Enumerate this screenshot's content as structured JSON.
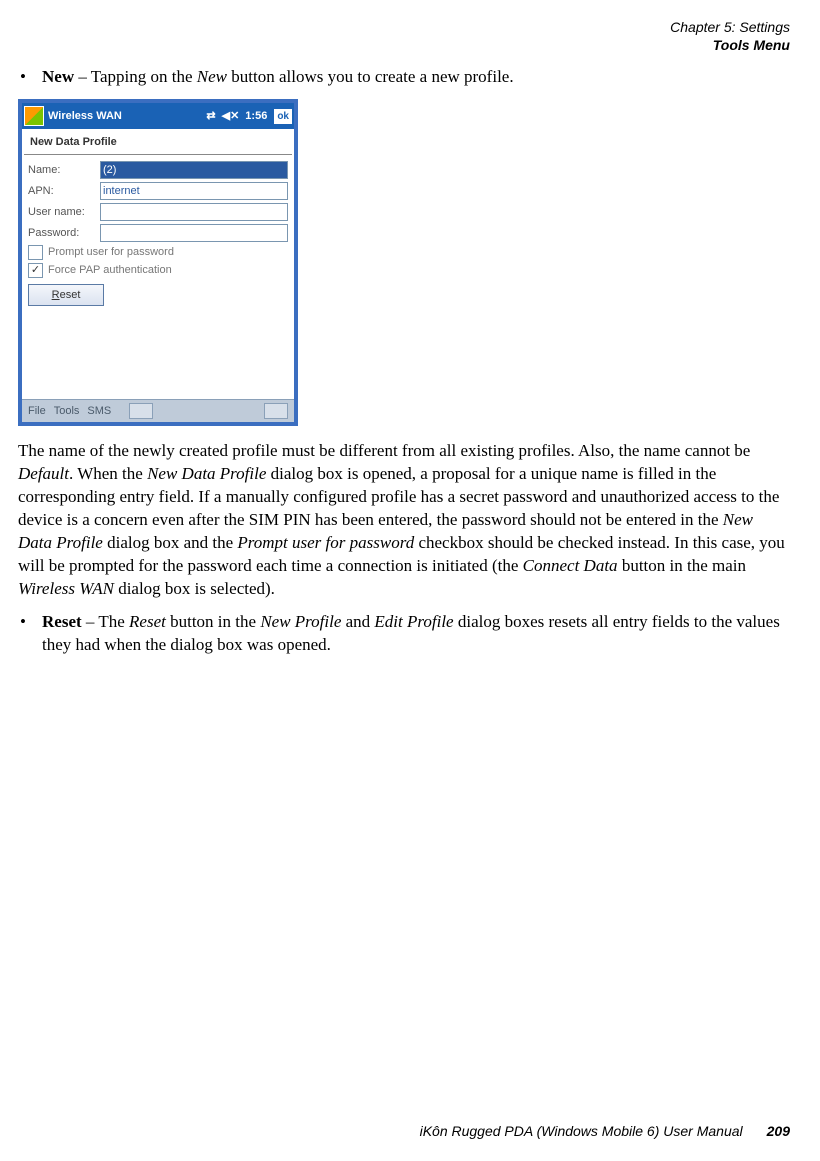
{
  "header": {
    "line1": "Chapter 5:  Settings",
    "line2": "Tools Menu"
  },
  "bullet1": {
    "term": "New",
    "sep": " – Tapping on the ",
    "ital1": "New",
    "rest": " button allows you to create a new profile."
  },
  "pda": {
    "title": "Wireless WAN",
    "time": "1:56",
    "ok": "ok",
    "subtitle": "New Data Profile",
    "labels": {
      "name": "Name:",
      "apn": "APN:",
      "user": "User name:",
      "pass": "Password:"
    },
    "values": {
      "name": "(2)",
      "apn": "internet",
      "user": "",
      "pass": ""
    },
    "chk1": "Prompt user for password",
    "chk2": "Force PAP authentication",
    "chk2mark": "✓",
    "reset_pre": "R",
    "reset_rest": "eset",
    "bottom": {
      "file": "File",
      "tools": "Tools",
      "sms": "SMS"
    }
  },
  "para1": {
    "t1": "The name of the newly created profile must be different from all existing profiles. Also, the name cannot be ",
    "i1": "Default",
    "t2": ". When the ",
    "i2": "New Data Profile",
    "t3": " dialog box is opened, a proposal for a unique name is filled in the corresponding entry field. If a manually configured profile has a secret password and unauthorized access to the device is a concern even after the SIM PIN has been entered, the password should not be entered in the ",
    "i3": "New Data Profile",
    "t4": " dialog box and the ",
    "i4": "Prompt user for password",
    "t5": " checkbox should be checked instead. In this case, you will be prompted for the password each time a connection is initiated (the ",
    "i5": "Connect Data",
    "t6": " button in the main ",
    "i6": "Wireless WAN",
    "t7": " dialog box is selected)."
  },
  "bullet2": {
    "term": "Reset",
    "t1": " – The ",
    "i1": "Reset",
    "t2": " button in the ",
    "i2": "New Profile",
    "t3": " and ",
    "i3": "Edit Profile",
    "t4": " dialog boxes resets all entry fields to the values they had when the dialog box was opened."
  },
  "footer": {
    "title": "iKôn Rugged PDA (Windows Mobile 6) User Manual",
    "page": "209"
  }
}
